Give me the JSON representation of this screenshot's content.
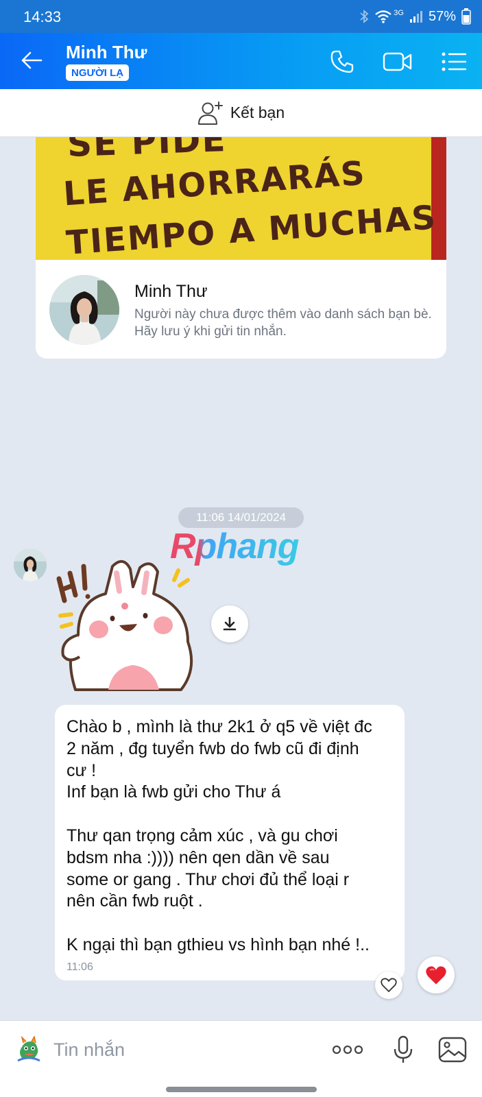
{
  "status_bar": {
    "time": "14:33",
    "battery": "57%",
    "network": "3G"
  },
  "header": {
    "contact_name": "Minh Thư",
    "badge": "NGƯỜI LẠ",
    "icons": [
      "back-arrow-icon",
      "phone-icon",
      "video-call-icon",
      "menu-list-icon"
    ]
  },
  "add_friend": {
    "label": "Kết bạn",
    "icon": "add-person-icon"
  },
  "profile_card": {
    "cover_lines": [
      "SE PIDE",
      "LE AHORRARÁS",
      "TIEMPO A MUCHAS"
    ],
    "name": "Minh Thư",
    "note": "Người này chưa được thêm vào danh sách bạn bè. Hãy lưu ý khi gửi tin nhắn."
  },
  "chat": {
    "timestamp": "11:06 14/01/2024",
    "watermark": "Rphang",
    "sticker_text": "HI!",
    "message": {
      "lines": [
        "Chào b , mình là thư 2k1 ở q5 về việt đc",
        "2 năm , đg tuyển fwb do fwb cũ đi định",
        "cư !",
        "Inf bạn là fwb gửi cho Thư á",
        "",
        "Thư qan trọng cảm xúc , và gu chơi",
        "bdsm nha :)))) nên qen dần về sau",
        "some or gang . Thư chơi đủ thể loại r",
        "nên cần fwb ruột .",
        "",
        "K ngại thì bạn gthieu vs hình bạn nhé !.."
      ],
      "time": "11:06"
    },
    "reaction": "heart-icon"
  },
  "input_bar": {
    "placeholder": "Tin nhắn",
    "icons": [
      "sticker-emoji-icon",
      "more-dots-icon",
      "microphone-icon",
      "image-icon"
    ]
  },
  "colors": {
    "header_start": "#0a68f6",
    "header_end": "#0ab2f2",
    "background": "#e2e8f1",
    "heart": "#e8202e"
  }
}
